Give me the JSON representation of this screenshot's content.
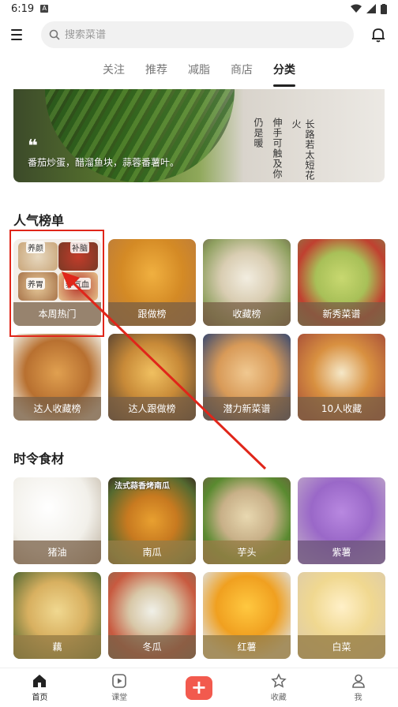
{
  "status": {
    "time": "6:19",
    "notif_icon": "A"
  },
  "search": {
    "placeholder": "搜索菜谱"
  },
  "tabs": [
    {
      "label": "关注",
      "active": false
    },
    {
      "label": "推荐",
      "active": false
    },
    {
      "label": "减脂",
      "active": false
    },
    {
      "label": "商店",
      "active": false
    },
    {
      "label": "分类",
      "active": true
    }
  ],
  "banner": {
    "caption": "番茄炒蛋，醋溜鱼块，蒜蓉番薯叶。",
    "vtext": [
      "仍是暖",
      "伸手可触及你",
      "长路若太短花火"
    ]
  },
  "popular": {
    "title": "人气榜单",
    "hot_tags": [
      "养颜",
      "补脑",
      "养胃",
      "养气血"
    ],
    "items": [
      {
        "label": "本周热门"
      },
      {
        "label": "跟做榜"
      },
      {
        "label": "收藏榜"
      },
      {
        "label": "新秀菜谱"
      },
      {
        "label": "达人收藏榜"
      },
      {
        "label": "达人跟做榜"
      },
      {
        "label": "潜力新菜谱"
      },
      {
        "label": "10人收藏"
      }
    ]
  },
  "seasonal": {
    "title": "时令食材",
    "overlay_text": "法式蒜香烤南瓜",
    "items": [
      {
        "label": "猪油"
      },
      {
        "label": "南瓜"
      },
      {
        "label": "芋头"
      },
      {
        "label": "紫薯"
      },
      {
        "label": "藕"
      },
      {
        "label": "冬瓜"
      },
      {
        "label": "红薯"
      },
      {
        "label": "白菜"
      }
    ]
  },
  "bottom_nav": [
    {
      "label": "首页",
      "icon": "home-icon",
      "active": true
    },
    {
      "label": "课堂",
      "icon": "play-icon",
      "active": false
    },
    {
      "label": "",
      "icon": "plus-icon",
      "active": false
    },
    {
      "label": "收藏",
      "icon": "star-icon",
      "active": false
    },
    {
      "label": "我",
      "icon": "user-icon",
      "active": false
    }
  ],
  "colors": {
    "accent": "#f25a4e",
    "highlight": "#e0261a"
  }
}
